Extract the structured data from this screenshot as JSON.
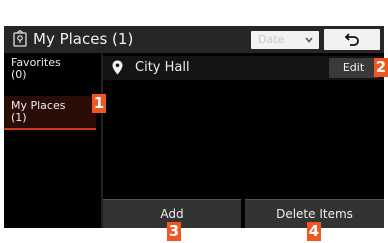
{
  "header": {
    "title": "My Places (1)",
    "sort_label": "Date"
  },
  "sidebar": {
    "items": [
      {
        "label": "Favorites",
        "count": "(0)"
      },
      {
        "label": "My Places",
        "count": "(1)"
      }
    ]
  },
  "list": {
    "rows": [
      {
        "label": "City Hall",
        "edit_label": "Edit"
      }
    ]
  },
  "buttons": {
    "add_label": "Add",
    "delete_label": "Delete Items"
  },
  "callouts": [
    "1",
    "2",
    "3",
    "4"
  ],
  "colors": {
    "accent": "#f0561f",
    "selected_bg": "#2b0d07"
  }
}
